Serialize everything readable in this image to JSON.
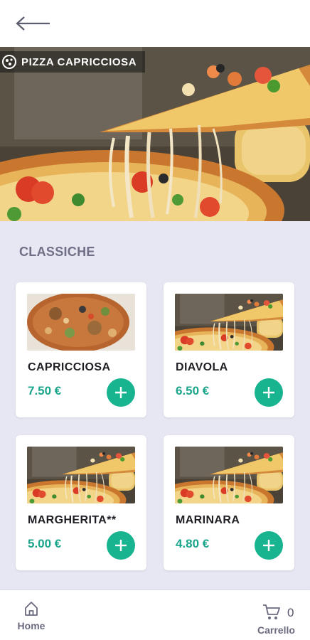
{
  "hero": {
    "logo_text": "PIZZA CAPRICCIOSA"
  },
  "section": {
    "title": "CLASSICHE"
  },
  "products": [
    {
      "name": "CAPRICCIOSA",
      "price": "7.50 €"
    },
    {
      "name": "DIAVOLA",
      "price": "6.50 €"
    },
    {
      "name": "MARGHERITA**",
      "price": "5.00 €"
    },
    {
      "name": "MARINARA",
      "price": "4.80 €"
    }
  ],
  "nav": {
    "home_label": "Home",
    "cart_label": "Carrello",
    "cart_count": "0"
  },
  "icons": {
    "back": "arrow-left-icon",
    "add": "plus-icon",
    "home": "home-icon",
    "cart": "cart-icon",
    "logo": "pizza-logo-icon"
  },
  "colors": {
    "accent": "#17b48f",
    "price": "#1aa58b",
    "background": "#e6e7f2",
    "section_title": "#6f7086"
  }
}
